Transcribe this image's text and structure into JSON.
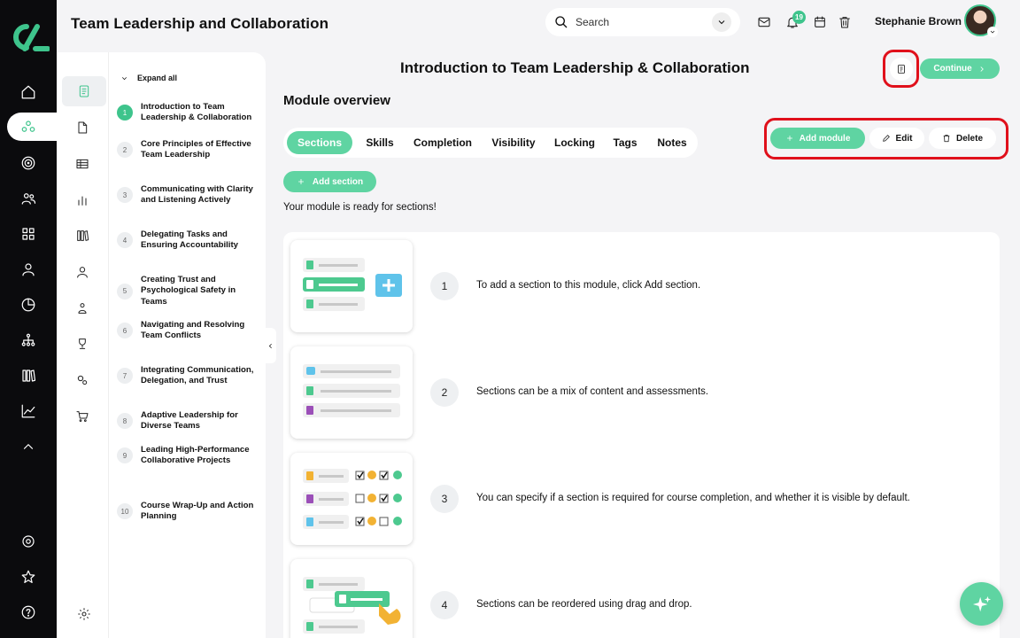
{
  "app": {
    "title": "Team Leadership and Collaboration",
    "brand_color": "#3ec48c"
  },
  "header": {
    "search_placeholder": "Search",
    "notifications_count": "19",
    "user_name": "Stephanie Brown"
  },
  "outline": {
    "expand_all": "Expand all",
    "modules": [
      {
        "num": "1",
        "title": "Introduction to Team Leadership & Collaboration"
      },
      {
        "num": "2",
        "title": "Core Principles of Effective Team Leadership"
      },
      {
        "num": "3",
        "title": "Communicating with Clarity and Listening Actively"
      },
      {
        "num": "4",
        "title": "Delegating Tasks and Ensuring Accountability"
      },
      {
        "num": "5",
        "title": "Creating Trust and Psychological Safety in Teams"
      },
      {
        "num": "6",
        "title": "Navigating and Resolving Team Conflicts"
      },
      {
        "num": "7",
        "title": "Integrating Communication, Delegation, and Trust"
      },
      {
        "num": "8",
        "title": "Adaptive Leadership for Diverse Teams"
      },
      {
        "num": "9",
        "title": "Leading High-Performance Collaborative Projects"
      },
      {
        "num": "10",
        "title": "Course Wrap-Up and Action Planning"
      }
    ]
  },
  "main": {
    "page_title": "Introduction to Team Leadership & Collaboration",
    "continue_label": "Continue",
    "section_heading": "Module overview",
    "tabs": [
      "Sections",
      "Skills",
      "Completion",
      "Visibility",
      "Locking",
      "Tags",
      "Notes"
    ],
    "actions": {
      "add_module": "Add module",
      "edit": "Edit",
      "delete": "Delete"
    },
    "add_section": "Add section",
    "ready_text": "Your module is ready for sections!",
    "steps": [
      {
        "num": "1",
        "text": "To add a section to this module, click Add section."
      },
      {
        "num": "2",
        "text": "Sections can be a mix of content and assessments."
      },
      {
        "num": "3",
        "text": "You can specify if a section is required for course completion, and whether it is visible by default."
      },
      {
        "num": "4",
        "text": "Sections can be reordered using drag and drop."
      }
    ]
  }
}
